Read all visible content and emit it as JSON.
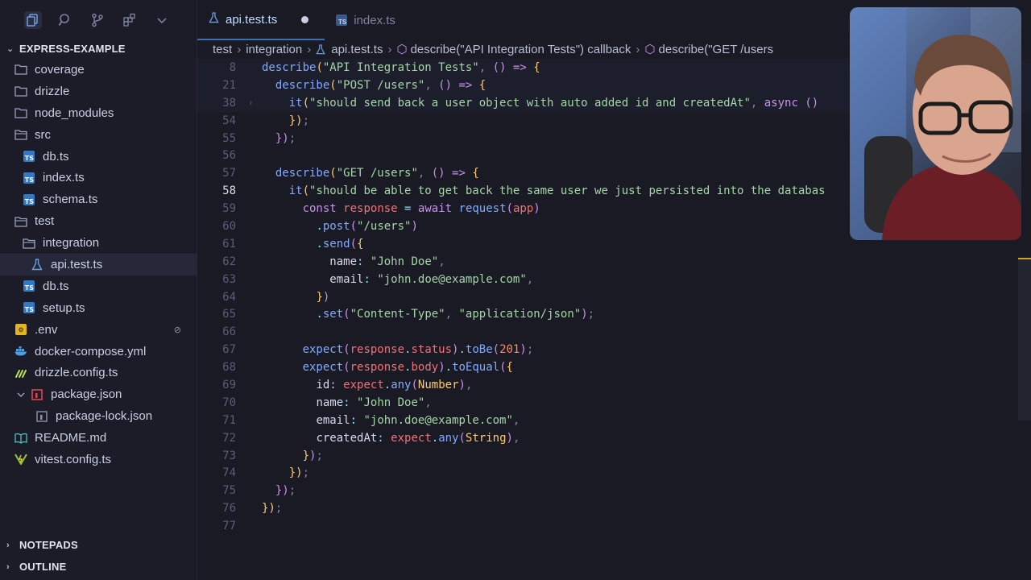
{
  "sidebar": {
    "explorer_title": "EXPRESS-EXAMPLE",
    "tree": [
      {
        "label": "coverage",
        "type": "folder",
        "depth": 0
      },
      {
        "label": "drizzle",
        "type": "folder",
        "depth": 0
      },
      {
        "label": "node_modules",
        "type": "folder",
        "depth": 0
      },
      {
        "label": "src",
        "type": "folder-open",
        "depth": 0
      },
      {
        "label": "db.ts",
        "type": "ts",
        "depth": 1
      },
      {
        "label": "index.ts",
        "type": "ts",
        "depth": 1
      },
      {
        "label": "schema.ts",
        "type": "ts",
        "depth": 1
      },
      {
        "label": "test",
        "type": "folder-open",
        "depth": 0
      },
      {
        "label": "integration",
        "type": "folder-open",
        "depth": 1
      },
      {
        "label": "api.test.ts",
        "type": "test",
        "depth": 2,
        "selected": true
      },
      {
        "label": "db.ts",
        "type": "ts",
        "depth": 1
      },
      {
        "label": "setup.ts",
        "type": "ts",
        "depth": 1
      },
      {
        "label": ".env",
        "type": "env",
        "depth": 0
      },
      {
        "label": "docker-compose.yml",
        "type": "docker",
        "depth": 0
      },
      {
        "label": "drizzle.config.ts",
        "type": "drizzle",
        "depth": 0
      },
      {
        "label": "package.json",
        "type": "npm",
        "depth": 0
      },
      {
        "label": "package-lock.json",
        "type": "npm-lock",
        "depth": 1
      },
      {
        "label": "README.md",
        "type": "readme",
        "depth": 0
      },
      {
        "label": "vitest.config.ts",
        "type": "vitest",
        "depth": 0
      }
    ],
    "notepads_label": "NOTEPADS",
    "outline_label": "OUTLINE"
  },
  "tabs": [
    {
      "label": "api.test.ts",
      "active": true,
      "modified": true
    },
    {
      "label": "index.ts",
      "active": false,
      "modified": false
    }
  ],
  "breadcrumbs": [
    "test",
    "integration",
    "api.test.ts",
    "describe(\"API Integration Tests\") callback",
    "describe(\"GET /users"
  ],
  "code": {
    "current_line": "58",
    "lines": [
      {
        "n": "8",
        "sticky": true
      },
      {
        "n": "21",
        "sticky": true
      },
      {
        "n": "38",
        "sticky": true
      },
      {
        "n": "54"
      },
      {
        "n": "55"
      },
      {
        "n": "56"
      },
      {
        "n": "57"
      },
      {
        "n": "58"
      },
      {
        "n": "59"
      },
      {
        "n": "60"
      },
      {
        "n": "61"
      },
      {
        "n": "62"
      },
      {
        "n": "63"
      },
      {
        "n": "64"
      },
      {
        "n": "65"
      },
      {
        "n": "66"
      },
      {
        "n": "67"
      },
      {
        "n": "68"
      },
      {
        "n": "69"
      },
      {
        "n": "70"
      },
      {
        "n": "71"
      },
      {
        "n": "72"
      },
      {
        "n": "73"
      },
      {
        "n": "74"
      },
      {
        "n": "75"
      },
      {
        "n": "76"
      },
      {
        "n": "77"
      }
    ],
    "snippets": {
      "l8_describe": "describe",
      "l8_title": "\"API Integration Tests\"",
      "l21_describe": "describe",
      "l21_title": "\"POST /users\"",
      "l38_it": "it",
      "l38_title": "\"should send back a user object with auto added id and createdAt\"",
      "l38_async": "async",
      "l57_describe": "describe",
      "l57_title": "\"GET /users\"",
      "l58_it": "it",
      "l58_title": "\"should be able to get back the same user we just persisted into the databas",
      "l59_const": "const",
      "l59_response": "response",
      "l59_await": "await",
      "l59_request": "request",
      "l59_app": "app",
      "l60_post": "post",
      "l60_path": "\"/users\"",
      "l61_send": "send",
      "l62_key": "name",
      "l62_val": "\"John Doe\"",
      "l63_key": "email",
      "l63_val": "\"john.doe@example.com\"",
      "l65_set": "set",
      "l65_h": "\"Content-Type\"",
      "l65_v": "\"application/json\"",
      "l67_expect": "expect",
      "l67_response": "response",
      "l67_status": "status",
      "l67_tobe": "toBe",
      "l67_num": "201",
      "l68_expect": "expect",
      "l68_response": "response",
      "l68_body": "body",
      "l68_toequal": "toEqual",
      "l69_key": "id",
      "l69_expect": "expect",
      "l69_any": "any",
      "l69_type": "Number",
      "l70_key": "name",
      "l70_val": "\"John Doe\"",
      "l71_key": "email",
      "l71_val": "\"john.doe@example.com\"",
      "l72_key": "createdAt",
      "l72_expect": "expect",
      "l72_any": "any",
      "l72_type": "String"
    }
  },
  "colors": {
    "ts_badge": "#3178c6",
    "accent_tab": "#3a6fb0",
    "string": "#a5d6a7",
    "keyword": "#c792ea",
    "function": "#82aaff",
    "number": "#f78c6c"
  }
}
